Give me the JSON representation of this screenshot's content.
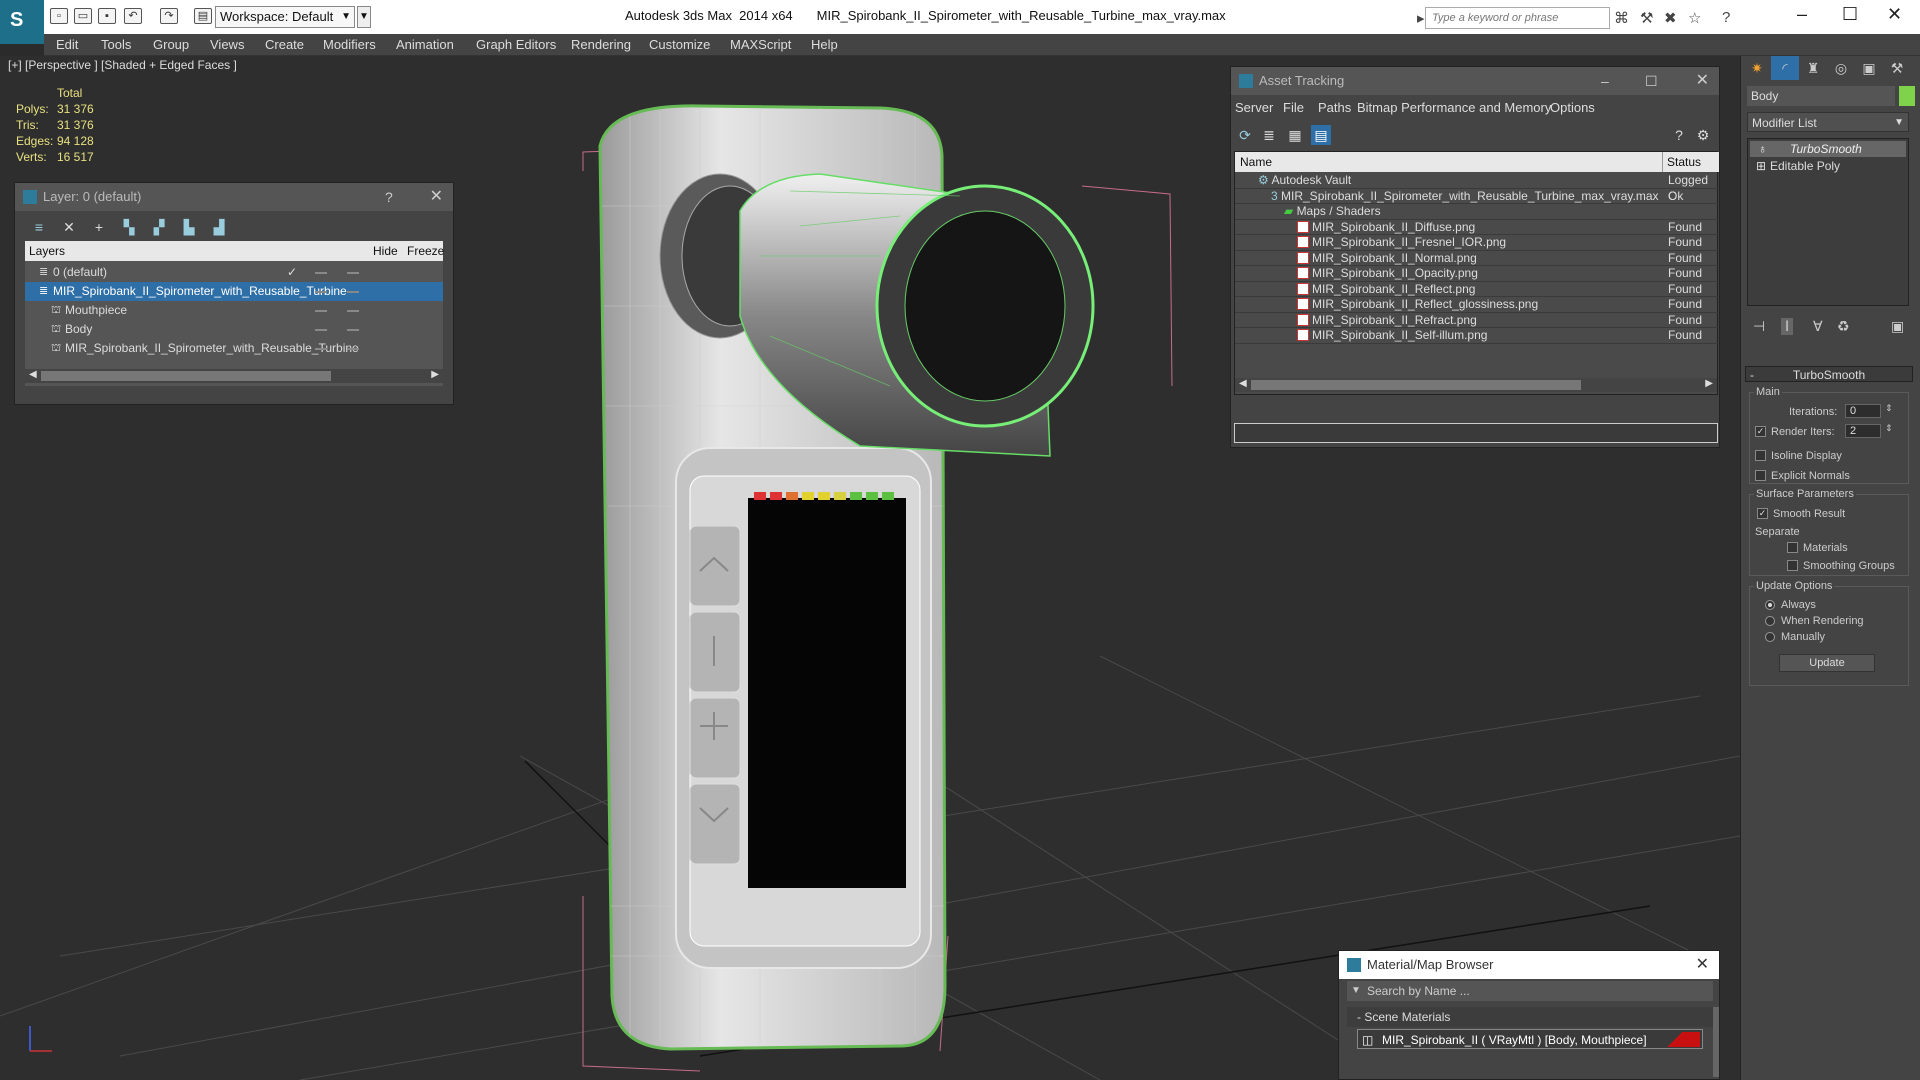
{
  "title": {
    "app": "Autodesk 3ds Max  2014 x64",
    "file": "MIR_Spirobank_II_Spirometer_with_Reusable_Turbine_max_vray.max",
    "workspace": "Workspace: Default",
    "search_placeholder": "Type a keyword or phrase"
  },
  "menu": [
    "Edit",
    "Tools",
    "Group",
    "Views",
    "Create",
    "Modifiers",
    "Animation",
    "Graph Editors",
    "Rendering",
    "Customize",
    "MAXScript",
    "Help"
  ],
  "viewport": {
    "label": "[+] [Perspective ] [Shaded + Edged Faces ]",
    "stats": {
      "header": "Total",
      "rows": [
        {
          "label": "Polys:",
          "value": "31 376"
        },
        {
          "label": "Tris:",
          "value": "31 376"
        },
        {
          "label": "Edges:",
          "value": "94 128"
        },
        {
          "label": "Verts:",
          "value": "16 517"
        }
      ]
    }
  },
  "layers_panel": {
    "title": "Layer: 0 (default)",
    "help": "?",
    "close": "✕",
    "columns": [
      "Layers",
      "Hide",
      "Freeze"
    ],
    "rows": [
      {
        "name": "0 (default)",
        "check": "✓",
        "selected": false,
        "indent": 1
      },
      {
        "name": "MIR_Spirobank_II_Spirometer_with_Reusable_Turbine",
        "check": "",
        "selected": true,
        "indent": 1
      },
      {
        "name": "Mouthpiece",
        "check": "",
        "selected": false,
        "indent": 2
      },
      {
        "name": "Body",
        "check": "",
        "selected": false,
        "indent": 2
      },
      {
        "name": "MIR_Spirobank_II_Spirometer_with_Reusable_Turbine",
        "check": "",
        "selected": false,
        "indent": 2
      }
    ]
  },
  "asset_tracking": {
    "title": "Asset Tracking",
    "menu": [
      "Server",
      "File",
      "Paths",
      "Bitmap Performance and Memory",
      "Options"
    ],
    "columns": [
      "Name",
      "Status"
    ],
    "rows": [
      {
        "name": "Autodesk Vault",
        "status": "Logged C",
        "indent": 1,
        "icon": "vault-icon"
      },
      {
        "name": "MIR_Spirobank_II_Spirometer_with_Reusable_Turbine_max_vray.max",
        "status": "Ok",
        "indent": 2,
        "icon": "max-file-icon"
      },
      {
        "name": "Maps / Shaders",
        "status": "",
        "indent": 3,
        "icon": "maps-folder-icon"
      },
      {
        "name": "MIR_Spirobank_II_Diffuse.png",
        "status": "Found",
        "indent": 4,
        "icon": "png-icon"
      },
      {
        "name": "MIR_Spirobank_II_Fresnel_IOR.png",
        "status": "Found",
        "indent": 4,
        "icon": "png-icon"
      },
      {
        "name": "MIR_Spirobank_II_Normal.png",
        "status": "Found",
        "indent": 4,
        "icon": "png-icon"
      },
      {
        "name": "MIR_Spirobank_II_Opacity.png",
        "status": "Found",
        "indent": 4,
        "icon": "png-icon"
      },
      {
        "name": "MIR_Spirobank_II_Reflect.png",
        "status": "Found",
        "indent": 4,
        "icon": "png-icon"
      },
      {
        "name": "MIR_Spirobank_II_Reflect_glossiness.png",
        "status": "Found",
        "indent": 4,
        "icon": "png-icon"
      },
      {
        "name": "MIR_Spirobank_II_Refract.png",
        "status": "Found",
        "indent": 4,
        "icon": "png-icon"
      },
      {
        "name": "MIR_Spirobank_II_Self-illum.png",
        "status": "Found",
        "indent": 4,
        "icon": "png-icon"
      }
    ]
  },
  "material_browser": {
    "title": "Material/Map Browser",
    "search_placeholder": "Search by Name ...",
    "section": "- Scene Materials",
    "item": "MIR_Spirobank_II  ( VRayMtl )  [Body, Mouthpiece]"
  },
  "command_panel": {
    "object_name": "Body",
    "object_color": "#7ed34a",
    "modifier_list": "Modifier List",
    "stack": [
      "TurboSmooth",
      "Editable Poly"
    ],
    "rollout_title": "TurboSmooth",
    "main_label": "Main",
    "iterations_label": "Iterations:",
    "iterations_value": "0",
    "render_iters_label": "Render Iters:",
    "render_iters_value": "2",
    "render_iters_checked": "✓",
    "isoline_label": "Isoline Display",
    "explicit_normals_label": "Explicit Normals",
    "surface_params_label": "Surface Parameters",
    "smooth_result_label": "Smooth Result",
    "smooth_result_checked": "✓",
    "separate_label": "Separate",
    "materials_label": "Materials",
    "smoothing_groups_label": "Smoothing Groups",
    "update_options_label": "Update Options",
    "always_label": "Always",
    "when_rendering_label": "When Rendering",
    "manually_label": "Manually",
    "update_button": "Update"
  }
}
